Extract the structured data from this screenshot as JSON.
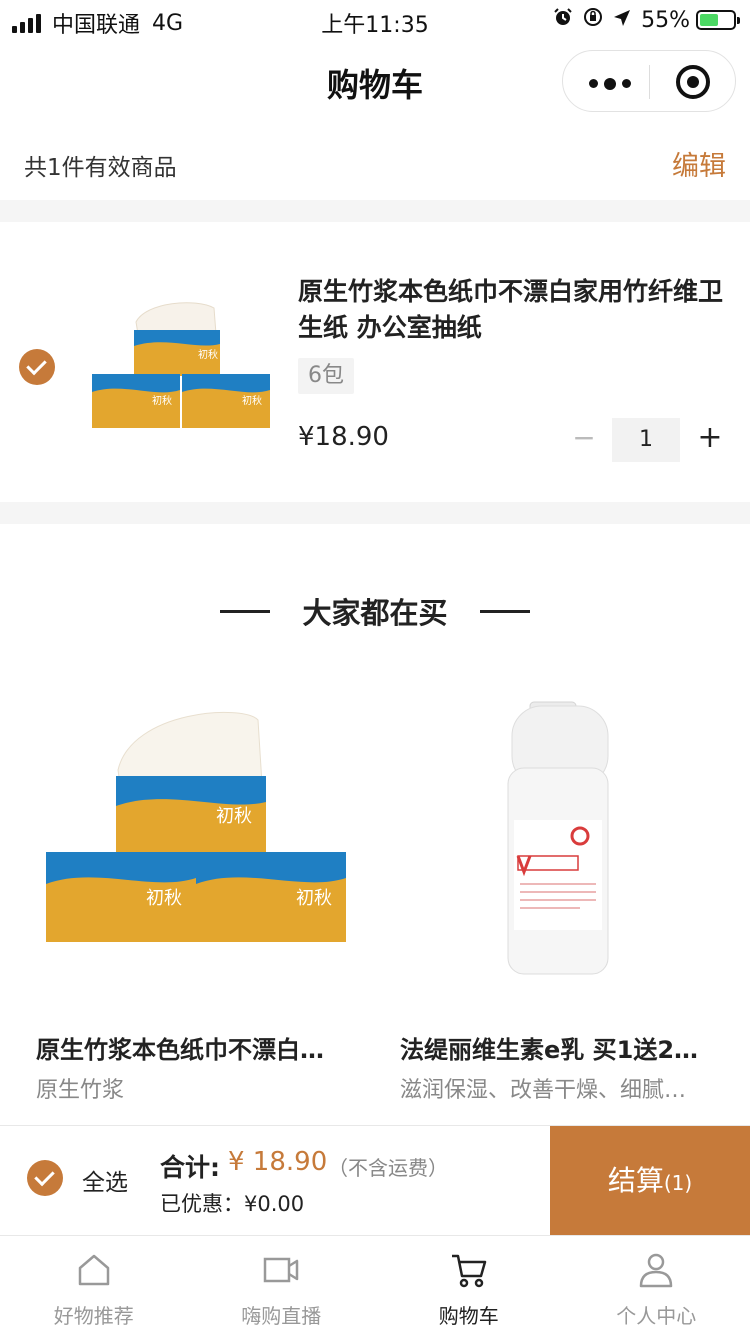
{
  "status_bar": {
    "carrier": "中国联通",
    "network": "4G",
    "time": "上午11:35",
    "battery": "55%",
    "battery_level": 0.55
  },
  "nav": {
    "title": "购物车"
  },
  "summary": {
    "count_text": "共1件有效商品",
    "edit_label": "编辑"
  },
  "cart": {
    "items": [
      {
        "title": "原生竹浆本色纸巾不漂白家用竹纤维卫生纸 办公室抽纸",
        "spec": "6包",
        "price": "¥18.90",
        "quantity": "1",
        "selected": true
      }
    ],
    "minus_label": "−",
    "plus_label": "+"
  },
  "recommend": {
    "heading": "大家都在买",
    "products": [
      {
        "title": "原生竹浆本色纸巾不漂白…",
        "subtitle": "原生竹浆"
      },
      {
        "title": "法缇丽维生素e乳 买1送2…",
        "subtitle": "滋润保湿、改善干燥、细腻…"
      }
    ]
  },
  "checkout": {
    "select_all_label": "全选",
    "total_label": "合计:",
    "total_value": "¥ 18.90",
    "shipping_note": "（不含运费）",
    "discount_text": "已优惠：¥0.00",
    "submit_label": "结算",
    "submit_count": "(1)"
  },
  "tabs": [
    {
      "label": "好物推荐",
      "icon": "home-icon",
      "active": false
    },
    {
      "label": "嗨购直播",
      "icon": "video-icon",
      "active": false
    },
    {
      "label": "购物车",
      "icon": "cart-icon",
      "active": true
    },
    {
      "label": "个人中心",
      "icon": "user-icon",
      "active": false
    }
  ],
  "colors": {
    "accent": "#c67a3a",
    "tab_inactive": "#999999",
    "tab_active": "#222222"
  },
  "product_box_text": "初秋"
}
